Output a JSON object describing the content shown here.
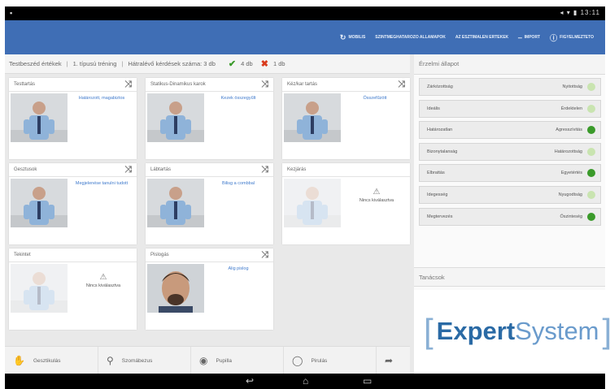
{
  "appbar": {
    "actions": [
      {
        "icon": "refresh-icon",
        "label": "MOBILIS"
      },
      {
        "icon": "",
        "label": "SZINTMEGHATAROZO ALLAMAPOK"
      },
      {
        "icon": "",
        "label": "AZ ESZTIMALEN ERTEKEK"
      },
      {
        "icon": "",
        "label": "IMPORT"
      },
      {
        "icon": "",
        "label": "FIGYELMEZTETO"
      }
    ]
  },
  "summary": {
    "title": "Testbeszéd értékek",
    "type": "1. típusú tréning",
    "pending": "Hátralévő kérdések száma: 3 db",
    "ok_count": "4 db",
    "bad_count": "1 db"
  },
  "cards": [
    {
      "title": "Testtartás",
      "desc": "Határozott, magabiztos",
      "closable": true,
      "faded": false,
      "warning": ""
    },
    {
      "title": "Statikus-Dinamikus karok",
      "desc": "Kezek összegyűlt",
      "closable": true,
      "faded": false,
      "warning": ""
    },
    {
      "title": "Kéz/kar tartás",
      "desc": "Összefűzött",
      "closable": true,
      "faded": false,
      "warning": ""
    },
    {
      "title": "Gesztusok",
      "desc": "Megjelenése tanulni tudott",
      "closable": true,
      "faded": false,
      "warning": ""
    },
    {
      "title": "Lábtartás",
      "desc": "Bilisg a combbal",
      "closable": true,
      "faded": false,
      "warning": ""
    },
    {
      "title": "Kezjárás",
      "desc": "",
      "closable": false,
      "faded": true,
      "warning": "Nincs kiválasztva"
    },
    {
      "title": "Tekintet",
      "desc": "",
      "closable": false,
      "faded": true,
      "warning": "Nincs kiválasztva"
    },
    {
      "title": "Pislogás",
      "desc": "Alig pislog",
      "closable": true,
      "faded": false,
      "warning": ""
    }
  ],
  "toolbar": [
    {
      "icon": "hand-icon",
      "label": "Gesztikulás"
    },
    {
      "icon": "figure-icon",
      "label": "Szomábezus"
    },
    {
      "icon": "eye-icon",
      "label": "Pupilla"
    },
    {
      "icon": "circle-icon",
      "label": "Pirulás"
    },
    {
      "icon": "arrow-icon",
      "label": ""
    }
  ],
  "right": {
    "title": "Érzelmi állapot",
    "rows": [
      {
        "label": "Zárkózottság",
        "value": "Nyitottság",
        "status": "#c9e4b0"
      },
      {
        "label": "Ideális",
        "value": "Érdektelen",
        "status": "#c9e4b0"
      },
      {
        "label": "Határozatlan",
        "value": "Agresszívitás",
        "status": "#3a9a2a"
      },
      {
        "label": "Bizonytalanság",
        "value": "Határozottság",
        "status": "#c9e4b0"
      },
      {
        "label": "Elbrattás",
        "value": "Egyetértés",
        "status": "#3a9a2a"
      },
      {
        "label": "Idegesség",
        "value": "Nyugodtság",
        "status": "#c9e4b0"
      },
      {
        "label": "Megtervezés",
        "value": "Őszinteség",
        "status": "#3a9a2a"
      }
    ],
    "tips_title": "Tanácsok",
    "logo_a": "Expert",
    "logo_b": "System"
  },
  "status": {
    "time": "13:11"
  }
}
